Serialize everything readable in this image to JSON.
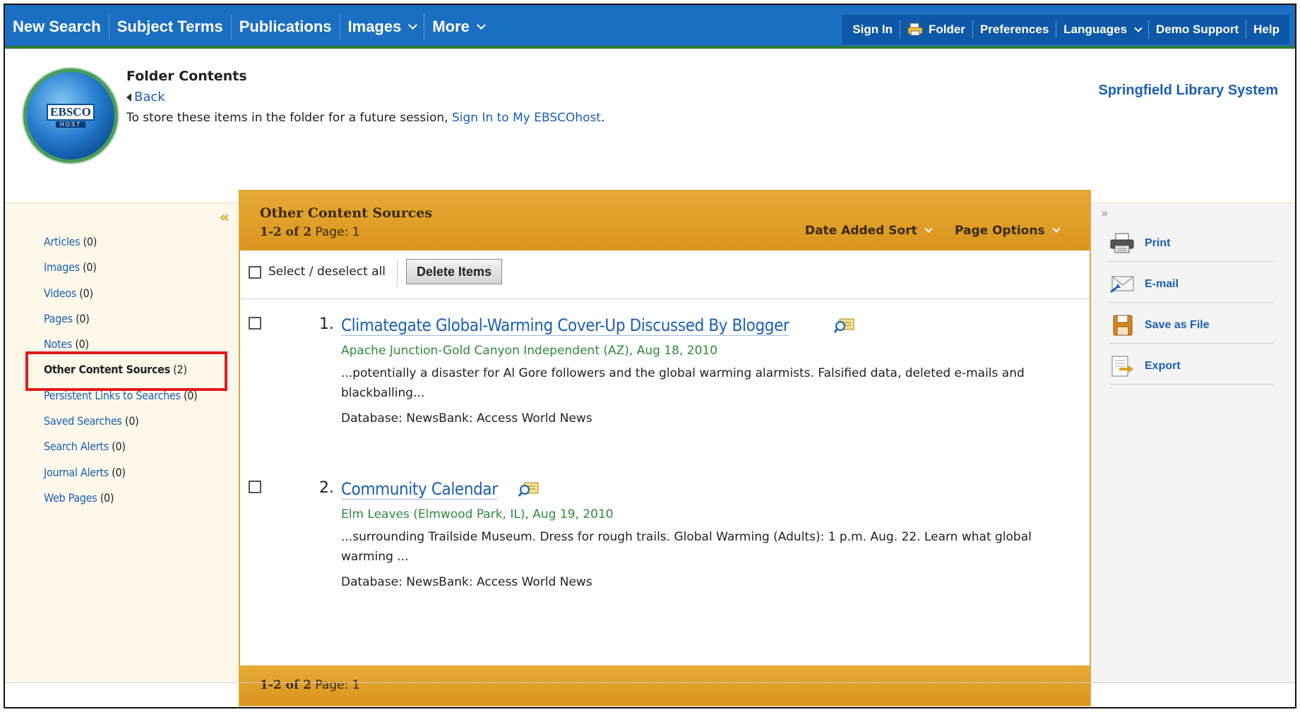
{
  "nav": {
    "items": [
      {
        "label": "New Search"
      },
      {
        "label": "Subject Terms"
      },
      {
        "label": "Publications"
      },
      {
        "label": "Images"
      },
      {
        "label": "More"
      }
    ]
  },
  "userbar": {
    "items": [
      {
        "label": "Sign In"
      },
      {
        "label": "Folder"
      },
      {
        "label": "Preferences"
      },
      {
        "label": "Languages"
      },
      {
        "label": "Demo Support"
      },
      {
        "label": "Help"
      }
    ]
  },
  "header": {
    "logo_text": "EBSCO",
    "logo_sub": "HOST",
    "title": "Folder Contents",
    "back_label": "Back",
    "store_text": "To store these items in the folder for a future session,",
    "sign_in_link": "Sign In to My EBSCOhost",
    "store_text_end": ".",
    "library_name": "Springfield Library System"
  },
  "sidebar": {
    "collapse_label": "«",
    "items": [
      {
        "label": "Articles",
        "count": "(0)"
      },
      {
        "label": "Images",
        "count": "(0)"
      },
      {
        "label": "Videos",
        "count": "(0)"
      },
      {
        "label": "Pages",
        "count": "(0)"
      },
      {
        "label": "Notes",
        "count": "(0)"
      },
      {
        "label": "Other Content Sources",
        "count": "(2)",
        "active": true
      },
      {
        "label": "Persistent Links to Searches",
        "count": "(0)"
      },
      {
        "label": "Saved Searches",
        "count": "(0)"
      },
      {
        "label": "Search Alerts",
        "count": "(0)"
      },
      {
        "label": "Journal Alerts",
        "count": "(0)"
      },
      {
        "label": "Web Pages",
        "count": "(0)"
      }
    ]
  },
  "results": {
    "title": "Other Content Sources",
    "range": "1-2 of 2",
    "page_label": "Page: 1",
    "sort_label": "Date Added Sort",
    "options_label": "Page Options",
    "select_all_label": "Select / deselect all",
    "delete_label": "Delete Items",
    "items": [
      {
        "num": "1.",
        "title": "Climategate Global-Warming Cover-Up Discussed By Blogger",
        "source": "Apache Junction-Gold Canyon Independent (AZ), Aug 18, 2010",
        "abstract": "...potentially a disaster for Al Gore followers and the global warming alarmists. Falsified data, deleted e-mails and blackballing...",
        "database": "Database: NewsBank: Access World News"
      },
      {
        "num": "2.",
        "title": "Community Calendar",
        "source": "Elm Leaves (Elmwood Park, IL), Aug 19, 2010",
        "abstract": "...surrounding Trailside Museum. Dress for rough trails. Global Warming (Adults): 1 p.m. Aug. 22. Learn what global warming ...",
        "database": "Database: NewsBank: Access World News"
      }
    ]
  },
  "tools": {
    "collapse_label": "»",
    "items": [
      {
        "label": "Print",
        "icon": "printer-icon"
      },
      {
        "label": "E-mail",
        "icon": "email-icon"
      },
      {
        "label": "Save as File",
        "icon": "save-file-icon"
      },
      {
        "label": "Export",
        "icon": "export-icon"
      }
    ]
  },
  "colors": {
    "topbar": "#1b6fc2",
    "link": "#1a5fb4",
    "results_header": "#e0a43a",
    "source_green": "#2e8b3a",
    "highlight": "#e01b1b"
  }
}
